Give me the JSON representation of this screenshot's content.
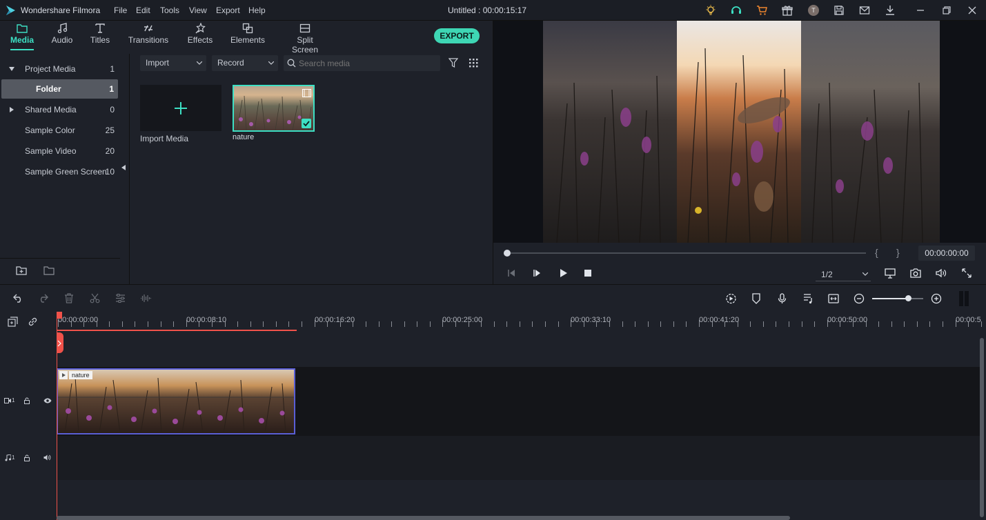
{
  "app": {
    "name": "Wondershare Filmora",
    "title": "Untitled : 00:00:15:17",
    "menu": [
      "File",
      "Edit",
      "Tools",
      "View",
      "Export",
      "Help"
    ],
    "avatar_letter": "T"
  },
  "tabs": [
    {
      "label": "Media",
      "icon": "folder-icon",
      "active": true
    },
    {
      "label": "Audio",
      "icon": "music-note-icon"
    },
    {
      "label": "Titles",
      "icon": "text-t-icon"
    },
    {
      "label": "Transitions",
      "icon": "transitions-icon"
    },
    {
      "label": "Effects",
      "icon": "effects-icon"
    },
    {
      "label": "Elements",
      "icon": "elements-icon"
    },
    {
      "label": "Split Screen",
      "icon": "split-screen-icon"
    }
  ],
  "export_label": "EXPORT",
  "sidebar": {
    "items": [
      {
        "label": "Project Media",
        "count": "1"
      },
      {
        "label": "Folder",
        "count": "1"
      },
      {
        "label": "Shared Media",
        "count": "0"
      },
      {
        "label": "Sample Color",
        "count": "25"
      },
      {
        "label": "Sample Video",
        "count": "20"
      },
      {
        "label": "Sample Green Screen",
        "count": "10"
      }
    ]
  },
  "media": {
    "import_dropdown": "Import",
    "record_dropdown": "Record",
    "search_placeholder": "Search media",
    "import_media_label": "Import Media",
    "clip_name": "nature"
  },
  "preview": {
    "timecode": "00:00:00:00",
    "quality": "1/2",
    "mark_in": "{",
    "mark_out": "}"
  },
  "timeline": {
    "ruler_labels": [
      "00:00:00:00",
      "00:00:08:10",
      "00:00:16:20",
      "00:00:25:00",
      "00:00:33:10",
      "00:00:41:20",
      "00:00:50:00",
      "00:00:5"
    ],
    "clip_label": "nature",
    "video_track_label": "1",
    "audio_track_label": "1",
    "zoom_level": 0.7
  },
  "colors": {
    "accent": "#3de0c4",
    "export_bg": "#3ed6b4",
    "playhead": "#f0524a",
    "clip_border": "#5a5fd6"
  }
}
